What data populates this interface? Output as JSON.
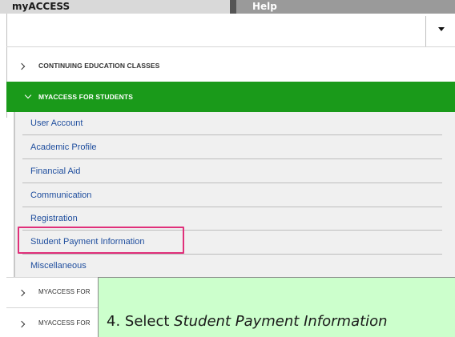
{
  "topbar": {
    "tab_myaccess": "myACCESS",
    "tab_help": "Help"
  },
  "menu": {
    "continuing_education": "CONTINUING EDUCATION CLASSES",
    "myaccess_students": "MYACCESS FOR STUDENTS",
    "myaccess_for_1": "MYACCESS FOR",
    "myaccess_for_2": "MYACCESS FOR"
  },
  "submenu": {
    "items": [
      "User Account",
      "Academic Profile",
      "Financial Aid",
      "Communication",
      "Registration",
      "Student Payment Information",
      "Miscellaneous"
    ],
    "highlighted": "Student Payment Information"
  },
  "callout": {
    "prefix": "4. Select ",
    "emphasis": "Student Payment Information"
  },
  "colors": {
    "green_header": "#1a9a1a",
    "callout_bg": "#ccffcc",
    "highlight_border": "#e0307a",
    "link_text": "#1f4e9e"
  },
  "icons": [
    "dropdown-caret-icon",
    "chevron-right-icon",
    "chevron-down-icon"
  ]
}
